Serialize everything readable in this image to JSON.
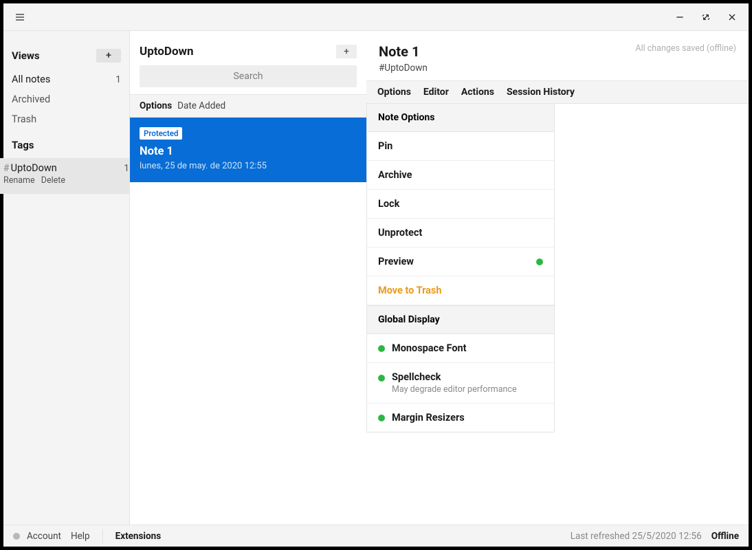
{
  "titlebar": {},
  "sidebar": {
    "views_label": "Views",
    "items": [
      {
        "label": "All notes",
        "count": "1"
      },
      {
        "label": "Archived",
        "count": ""
      },
      {
        "label": "Trash",
        "count": ""
      }
    ],
    "tags_label": "Tags",
    "tag_prefix": "#",
    "tag_name": "UptoDown",
    "tag_count": "1",
    "tag_rename": "Rename",
    "tag_delete": "Delete"
  },
  "list": {
    "title": "UptoDown",
    "search_placeholder": "Search",
    "sort_label_bold": "Options",
    "sort_label": "Date Added",
    "note": {
      "badge": "Protected",
      "title": "Note 1",
      "date": "lunes, 25 de may. de 2020 12:55"
    }
  },
  "editor": {
    "title": "Note 1",
    "tag": "#UptoDown",
    "save_status": "All changes saved (offline)",
    "tabs": [
      "Options",
      "Editor",
      "Actions",
      "Session History"
    ],
    "note_options_header": "Note Options",
    "options": {
      "pin": "Pin",
      "archive": "Archive",
      "lock": "Lock",
      "unprotect": "Unprotect",
      "preview": "Preview",
      "trash": "Move to Trash"
    },
    "global_header": "Global Display",
    "global": {
      "mono": "Monospace Font",
      "spell": "Spellcheck",
      "spell_sub": "May degrade editor performance",
      "resizers": "Margin Resizers"
    }
  },
  "footer": {
    "account": "Account",
    "help": "Help",
    "extensions": "Extensions",
    "refreshed": "Last refreshed 25/5/2020 12:56",
    "status": "Offline"
  }
}
